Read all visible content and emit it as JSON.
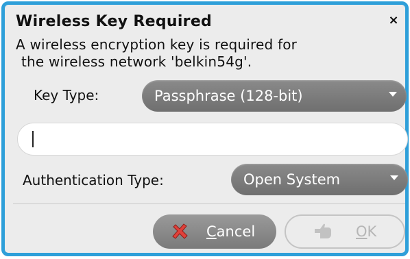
{
  "dialog": {
    "title": "Wireless Key Required",
    "message_line1": "A wireless encryption key is required for",
    "message_line2": "the wireless network 'belkin54g'.",
    "key_type_label": "Key Type:",
    "key_type_value": "Passphrase (128-bit)",
    "key_input_value": "",
    "auth_type_label": "Authentication Type:",
    "auth_type_value": "Open System",
    "cancel_mnemonic": "C",
    "cancel_rest": "ancel",
    "ok_mnemonic": "O",
    "ok_rest": "K",
    "close_glyph": "×"
  },
  "colors": {
    "border_accent": "#2e9fd9",
    "combo_bg": "#7d7d7d",
    "cancel_icon": "#e0413a",
    "ok_disabled": "#b6b6b6"
  },
  "icons": {
    "close": "close-icon",
    "cancel": "cancel-icon",
    "ok": "ok-icon",
    "dropdown": "chevron-down-icon"
  }
}
